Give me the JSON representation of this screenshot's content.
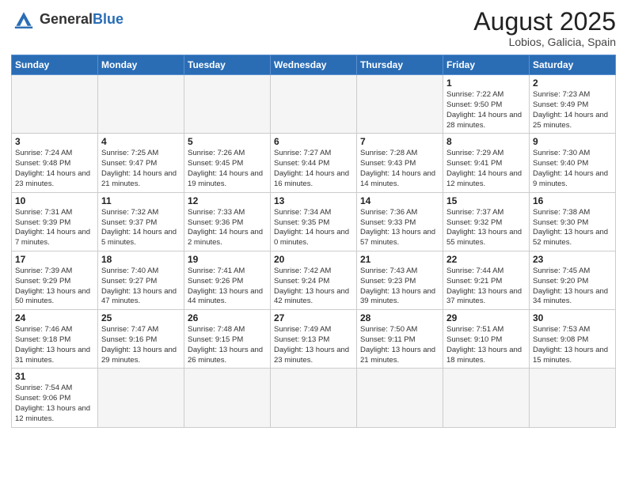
{
  "header": {
    "logo_general": "General",
    "logo_blue": "Blue",
    "month_title": "August 2025",
    "location": "Lobios, Galicia, Spain"
  },
  "weekdays": [
    "Sunday",
    "Monday",
    "Tuesday",
    "Wednesday",
    "Thursday",
    "Friday",
    "Saturday"
  ],
  "weeks": [
    [
      {
        "day": "",
        "info": ""
      },
      {
        "day": "",
        "info": ""
      },
      {
        "day": "",
        "info": ""
      },
      {
        "day": "",
        "info": ""
      },
      {
        "day": "",
        "info": ""
      },
      {
        "day": "1",
        "info": "Sunrise: 7:22 AM\nSunset: 9:50 PM\nDaylight: 14 hours and 28 minutes."
      },
      {
        "day": "2",
        "info": "Sunrise: 7:23 AM\nSunset: 9:49 PM\nDaylight: 14 hours and 25 minutes."
      }
    ],
    [
      {
        "day": "3",
        "info": "Sunrise: 7:24 AM\nSunset: 9:48 PM\nDaylight: 14 hours and 23 minutes."
      },
      {
        "day": "4",
        "info": "Sunrise: 7:25 AM\nSunset: 9:47 PM\nDaylight: 14 hours and 21 minutes."
      },
      {
        "day": "5",
        "info": "Sunrise: 7:26 AM\nSunset: 9:45 PM\nDaylight: 14 hours and 19 minutes."
      },
      {
        "day": "6",
        "info": "Sunrise: 7:27 AM\nSunset: 9:44 PM\nDaylight: 14 hours and 16 minutes."
      },
      {
        "day": "7",
        "info": "Sunrise: 7:28 AM\nSunset: 9:43 PM\nDaylight: 14 hours and 14 minutes."
      },
      {
        "day": "8",
        "info": "Sunrise: 7:29 AM\nSunset: 9:41 PM\nDaylight: 14 hours and 12 minutes."
      },
      {
        "day": "9",
        "info": "Sunrise: 7:30 AM\nSunset: 9:40 PM\nDaylight: 14 hours and 9 minutes."
      }
    ],
    [
      {
        "day": "10",
        "info": "Sunrise: 7:31 AM\nSunset: 9:39 PM\nDaylight: 14 hours and 7 minutes."
      },
      {
        "day": "11",
        "info": "Sunrise: 7:32 AM\nSunset: 9:37 PM\nDaylight: 14 hours and 5 minutes."
      },
      {
        "day": "12",
        "info": "Sunrise: 7:33 AM\nSunset: 9:36 PM\nDaylight: 14 hours and 2 minutes."
      },
      {
        "day": "13",
        "info": "Sunrise: 7:34 AM\nSunset: 9:35 PM\nDaylight: 14 hours and 0 minutes."
      },
      {
        "day": "14",
        "info": "Sunrise: 7:36 AM\nSunset: 9:33 PM\nDaylight: 13 hours and 57 minutes."
      },
      {
        "day": "15",
        "info": "Sunrise: 7:37 AM\nSunset: 9:32 PM\nDaylight: 13 hours and 55 minutes."
      },
      {
        "day": "16",
        "info": "Sunrise: 7:38 AM\nSunset: 9:30 PM\nDaylight: 13 hours and 52 minutes."
      }
    ],
    [
      {
        "day": "17",
        "info": "Sunrise: 7:39 AM\nSunset: 9:29 PM\nDaylight: 13 hours and 50 minutes."
      },
      {
        "day": "18",
        "info": "Sunrise: 7:40 AM\nSunset: 9:27 PM\nDaylight: 13 hours and 47 minutes."
      },
      {
        "day": "19",
        "info": "Sunrise: 7:41 AM\nSunset: 9:26 PM\nDaylight: 13 hours and 44 minutes."
      },
      {
        "day": "20",
        "info": "Sunrise: 7:42 AM\nSunset: 9:24 PM\nDaylight: 13 hours and 42 minutes."
      },
      {
        "day": "21",
        "info": "Sunrise: 7:43 AM\nSunset: 9:23 PM\nDaylight: 13 hours and 39 minutes."
      },
      {
        "day": "22",
        "info": "Sunrise: 7:44 AM\nSunset: 9:21 PM\nDaylight: 13 hours and 37 minutes."
      },
      {
        "day": "23",
        "info": "Sunrise: 7:45 AM\nSunset: 9:20 PM\nDaylight: 13 hours and 34 minutes."
      }
    ],
    [
      {
        "day": "24",
        "info": "Sunrise: 7:46 AM\nSunset: 9:18 PM\nDaylight: 13 hours and 31 minutes."
      },
      {
        "day": "25",
        "info": "Sunrise: 7:47 AM\nSunset: 9:16 PM\nDaylight: 13 hours and 29 minutes."
      },
      {
        "day": "26",
        "info": "Sunrise: 7:48 AM\nSunset: 9:15 PM\nDaylight: 13 hours and 26 minutes."
      },
      {
        "day": "27",
        "info": "Sunrise: 7:49 AM\nSunset: 9:13 PM\nDaylight: 13 hours and 23 minutes."
      },
      {
        "day": "28",
        "info": "Sunrise: 7:50 AM\nSunset: 9:11 PM\nDaylight: 13 hours and 21 minutes."
      },
      {
        "day": "29",
        "info": "Sunrise: 7:51 AM\nSunset: 9:10 PM\nDaylight: 13 hours and 18 minutes."
      },
      {
        "day": "30",
        "info": "Sunrise: 7:53 AM\nSunset: 9:08 PM\nDaylight: 13 hours and 15 minutes."
      }
    ],
    [
      {
        "day": "31",
        "info": "Sunrise: 7:54 AM\nSunset: 9:06 PM\nDaylight: 13 hours and 12 minutes."
      },
      {
        "day": "",
        "info": ""
      },
      {
        "day": "",
        "info": ""
      },
      {
        "day": "",
        "info": ""
      },
      {
        "day": "",
        "info": ""
      },
      {
        "day": "",
        "info": ""
      },
      {
        "day": "",
        "info": ""
      }
    ]
  ]
}
